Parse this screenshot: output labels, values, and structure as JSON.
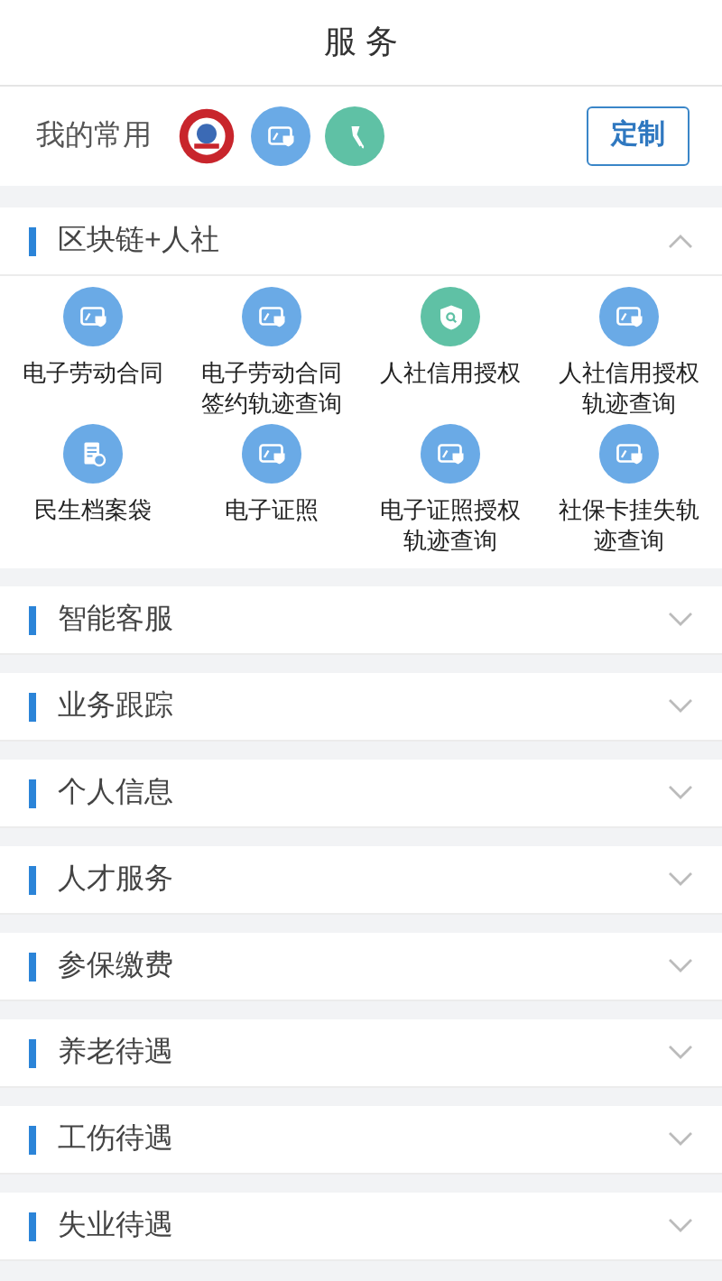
{
  "header": {
    "title": "服 务"
  },
  "favorites": {
    "label": "我的常用",
    "icons": [
      {
        "kind": "emblem"
      },
      {
        "kind": "card"
      },
      {
        "kind": "tool"
      }
    ],
    "button": "定制"
  },
  "sections": [
    {
      "title": "区块链+人社",
      "expanded": true,
      "items": [
        {
          "kind": "card",
          "label": "电子劳动合同"
        },
        {
          "kind": "card",
          "label": "电子劳动合同签约轨迹查询"
        },
        {
          "kind": "shield",
          "label": "人社信用授权"
        },
        {
          "kind": "card",
          "label": "人社信用授权轨迹查询"
        },
        {
          "kind": "file",
          "label": "民生档案袋"
        },
        {
          "kind": "card",
          "label": "电子证照"
        },
        {
          "kind": "card",
          "label": "电子证照授权轨迹查询"
        },
        {
          "kind": "card",
          "label": "社保卡挂失轨迹查询"
        }
      ]
    },
    {
      "title": "智能客服",
      "expanded": false
    },
    {
      "title": "业务跟踪",
      "expanded": false
    },
    {
      "title": "个人信息",
      "expanded": false
    },
    {
      "title": "人才服务",
      "expanded": false
    },
    {
      "title": "参保缴费",
      "expanded": false
    },
    {
      "title": "养老待遇",
      "expanded": false
    },
    {
      "title": "工伤待遇",
      "expanded": false
    },
    {
      "title": "失业待遇",
      "expanded": false
    }
  ]
}
